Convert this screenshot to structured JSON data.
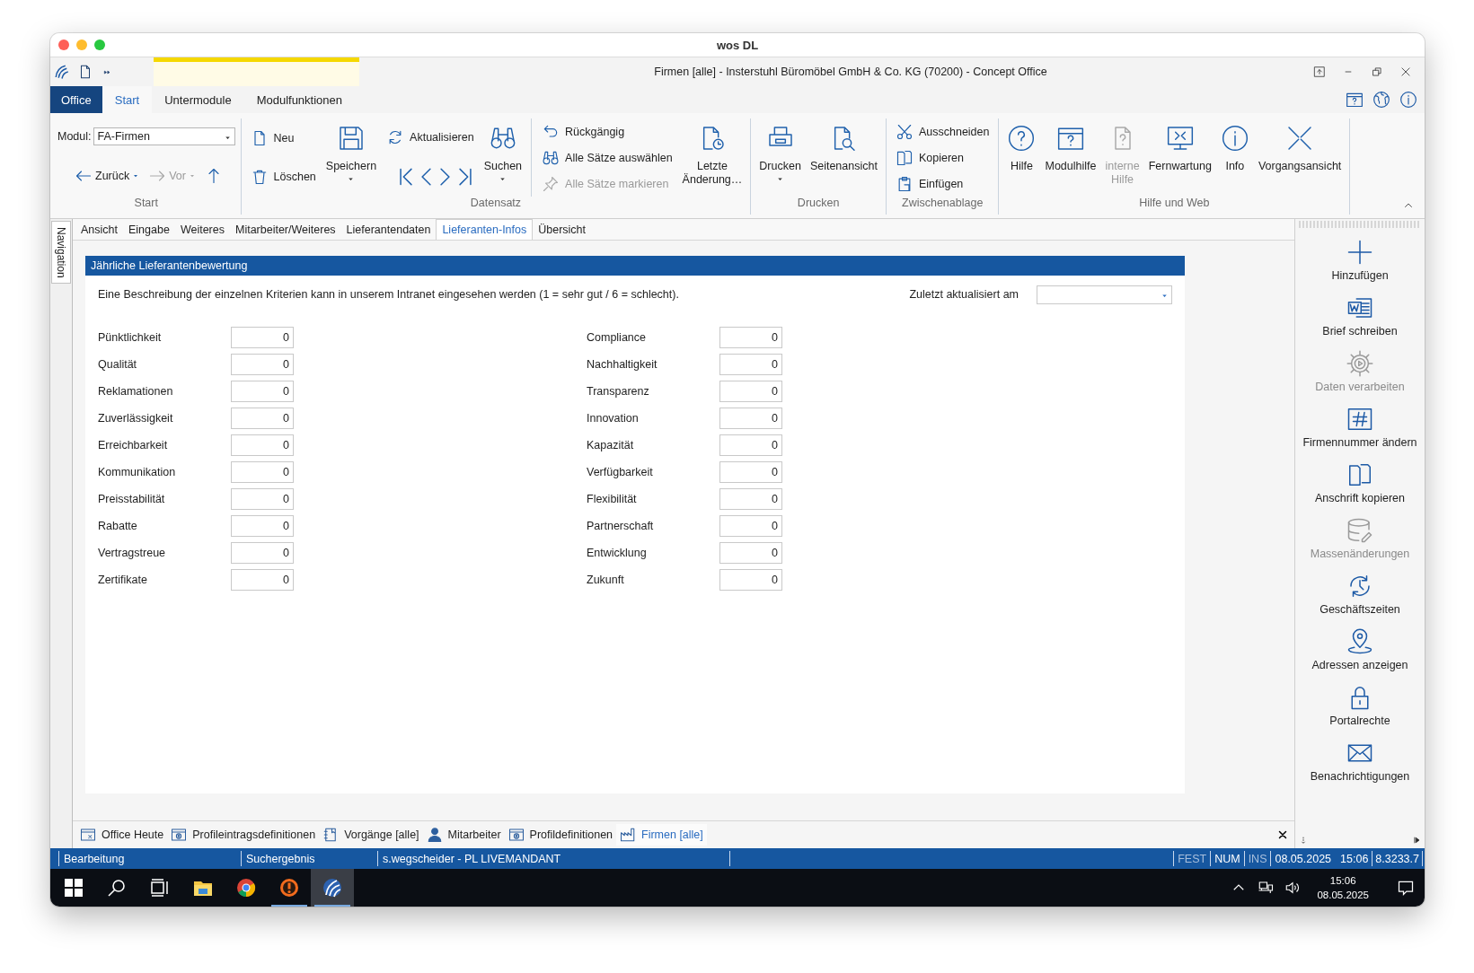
{
  "mac_window": {
    "title": "wos DL"
  },
  "app": {
    "title": "Firmen [alle] - Insterstuhl Büromöbel GmbH & Co. KG (70200) - Concept Office"
  },
  "ribbon_tabs": [
    {
      "label": "Office",
      "kind": "app-menu",
      "selected": false
    },
    {
      "label": "Start",
      "kind": "tab",
      "selected": true
    },
    {
      "label": "Untermodule",
      "kind": "tab",
      "selected": false
    },
    {
      "label": "Modulfunktionen",
      "kind": "tab",
      "selected": false
    }
  ],
  "ribbon_groups": [
    {
      "label": "Start",
      "columns": [
        {
          "kind": "stack",
          "items": [
            {
              "kind": "combo",
              "label": "Modul:",
              "value": "FA-Firmen"
            },
            {
              "kind": "navrow",
              "items": [
                {
                  "label": "Zurück",
                  "dropdown": true,
                  "disabled": false
                },
                {
                  "label": "Vor",
                  "dropdown": true,
                  "disabled": true
                },
                {
                  "dropdown": false,
                  "disabled": false
                }
              ]
            }
          ]
        }
      ]
    },
    {
      "label": "Datensatz",
      "columns": [
        {
          "kind": "stack",
          "items": [
            {
              "kind": "small",
              "label": "Neu",
              "disabled": false
            },
            {
              "kind": "small",
              "label": "Löschen",
              "disabled": false
            }
          ]
        },
        {
          "kind": "large",
          "label": "Speichern",
          "dropdown": true,
          "disabled": false
        },
        {
          "kind": "stack",
          "items": [
            {
              "kind": "small",
              "label": "Aktualisieren",
              "disabled": false
            },
            {
              "kind": "navrow",
              "items": [
                {
                  "dropdown": false,
                  "disabled": false
                },
                {
                  "dropdown": false,
                  "disabled": false
                },
                {
                  "dropdown": false,
                  "disabled": false
                },
                {
                  "dropdown": false,
                  "disabled": false
                }
              ]
            }
          ]
        },
        {
          "kind": "large",
          "label": "Suchen",
          "dropdown": true,
          "disabled": false
        },
        {
          "kind": "separator"
        },
        {
          "kind": "stack",
          "items": [
            {
              "kind": "small",
              "label": "Rückgängig",
              "disabled": false
            },
            {
              "kind": "small",
              "label": "Alle Sätze auswählen",
              "disabled": false
            },
            {
              "kind": "small",
              "label": "Alle Sätze markieren",
              "disabled": true
            }
          ]
        },
        {
          "kind": "large",
          "label": "Letzte\nÄnderung…",
          "dropdown": false,
          "disabled": false
        }
      ]
    },
    {
      "label": "Drucken",
      "columns": [
        {
          "kind": "large",
          "label": "Drucken",
          "dropdown": true,
          "disabled": false
        },
        {
          "kind": "large",
          "label": "Seitenansicht",
          "dropdown": false,
          "disabled": false
        }
      ]
    },
    {
      "label": "Zwischenablage",
      "columns": [
        {
          "kind": "stack",
          "items": [
            {
              "kind": "small",
              "label": "Ausschneiden",
              "disabled": false
            },
            {
              "kind": "small",
              "label": "Kopieren",
              "disabled": false
            },
            {
              "kind": "small",
              "label": "Einfügen",
              "disabled": false
            }
          ]
        }
      ]
    },
    {
      "label": "Hilfe und Web",
      "columns": [
        {
          "kind": "large",
          "label": "Hilfe",
          "dropdown": false,
          "disabled": false
        },
        {
          "kind": "large",
          "label": "Modulhilfe",
          "dropdown": false,
          "disabled": false
        },
        {
          "kind": "large",
          "label": "interne\nHilfe",
          "dropdown": false,
          "disabled": true
        },
        {
          "kind": "large",
          "label": "Fernwartung",
          "dropdown": false,
          "disabled": false
        },
        {
          "kind": "large",
          "label": "Info",
          "dropdown": false,
          "disabled": false
        },
        {
          "kind": "large",
          "label": "Vorgangsansicht",
          "dropdown": false,
          "disabled": false
        }
      ]
    }
  ],
  "navigation_tab": {
    "label": "Navigation"
  },
  "form_tabs": [
    {
      "label": "Ansicht",
      "selected": false
    },
    {
      "label": "Eingabe",
      "selected": false
    },
    {
      "label": "Weiteres",
      "selected": false
    },
    {
      "label": "Mitarbeiter/Weiteres",
      "selected": false
    },
    {
      "label": "Lieferantendaten",
      "selected": false
    },
    {
      "label": "Lieferanten-Infos",
      "selected": true
    },
    {
      "label": "Übersicht",
      "selected": false
    }
  ],
  "section": {
    "title": "Jährliche Lieferantenbewertung",
    "description": "Eine Beschreibung der einzelnen Kriterien kann in unserem Intranet eingesehen werden (1 = sehr gut / 6 = schlecht).",
    "last_updated": {
      "label": "Zuletzt aktualisiert am"
    },
    "criteria_columns": [
      [
        {
          "label": "Pünktlichkeit",
          "value": "0"
        },
        {
          "label": "Qualität",
          "value": "0"
        },
        {
          "label": "Reklamationen",
          "value": "0"
        },
        {
          "label": "Zuverlässigkeit",
          "value": "0"
        },
        {
          "label": "Erreichbarkeit",
          "value": "0"
        },
        {
          "label": "Kommunikation",
          "value": "0"
        },
        {
          "label": "Preisstabilität",
          "value": "0"
        },
        {
          "label": "Rabatte",
          "value": "0"
        },
        {
          "label": "Vertragstreue",
          "value": "0"
        },
        {
          "label": "Zertifikate",
          "value": "0"
        }
      ],
      [
        {
          "label": "Compliance",
          "value": "0"
        },
        {
          "label": "Nachhaltigkeit",
          "value": "0"
        },
        {
          "label": "Transparenz",
          "value": "0"
        },
        {
          "label": "Innovation",
          "value": "0"
        },
        {
          "label": "Kapazität",
          "value": "0"
        },
        {
          "label": "Verfügbarkeit",
          "value": "0"
        },
        {
          "label": "Flexibilität",
          "value": "0"
        },
        {
          "label": "Partnerschaft",
          "value": "0"
        },
        {
          "label": "Entwicklung",
          "value": "0"
        },
        {
          "label": "Zukunft",
          "value": "0"
        }
      ]
    ]
  },
  "side_actions": [
    {
      "label": "Hinzufügen",
      "disabled": false
    },
    {
      "label": "Brief schreiben",
      "disabled": false
    },
    {
      "label": "Daten verarbeiten",
      "disabled": true
    },
    {
      "label": "Firmennummer ändern",
      "disabled": false
    },
    {
      "label": "Anschrift kopieren",
      "disabled": false
    },
    {
      "label": "Massenänderungen",
      "disabled": true
    },
    {
      "label": "Geschäftszeiten",
      "disabled": false
    },
    {
      "label": "Adressen anzeigen",
      "disabled": false
    },
    {
      "label": "Portalrechte",
      "disabled": false
    },
    {
      "label": "Benachrichtigungen",
      "disabled": false
    }
  ],
  "doc_tabs": [
    {
      "label": "Office Heute",
      "selected": false
    },
    {
      "label": "Profileintragsdefinitionen",
      "selected": false
    },
    {
      "label": "Vorgänge [alle]",
      "selected": false
    },
    {
      "label": "Mitarbeiter",
      "selected": false
    },
    {
      "label": "Profildefinitionen",
      "selected": false
    },
    {
      "label": "Firmen [alle]",
      "selected": true
    }
  ],
  "status_bar": {
    "cells": [
      "Bearbeitung",
      "Suchergebnis",
      "s.wegscheider - PL LIVEMANDANT"
    ],
    "indicators": [
      {
        "label": "FEST",
        "on": false
      },
      {
        "label": "NUM",
        "on": true
      },
      {
        "label": "INS",
        "on": false
      }
    ],
    "date": "08.05.2025",
    "time": "15:06",
    "version": "8.3233.7"
  },
  "taskbar": {
    "buttons": [
      {
        "running": false,
        "active": false
      },
      {
        "running": false,
        "active": false
      },
      {
        "running": false,
        "active": false
      },
      {
        "running": false,
        "active": false
      },
      {
        "running": false,
        "active": false
      },
      {
        "running": true,
        "active": false
      },
      {
        "running": true,
        "active": true
      }
    ],
    "time": "15:06",
    "date": "08.05.2025"
  }
}
